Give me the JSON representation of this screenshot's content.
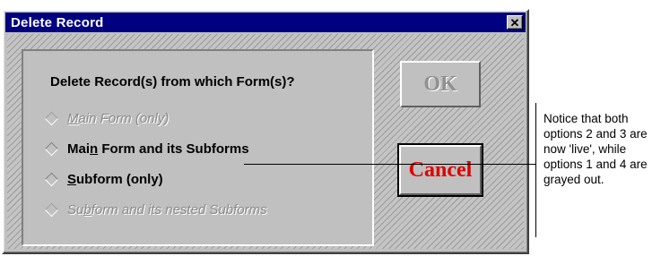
{
  "window": {
    "title": "Delete Record",
    "close_glyph": "✕"
  },
  "group": {
    "title": "Delete Record(s) from which Form(s)?",
    "options": [
      {
        "pre": "",
        "key": "M",
        "post": "ain Form (only)",
        "enabled": false
      },
      {
        "pre": "Mai",
        "key": "n",
        "post": " Form and its Subforms",
        "enabled": true
      },
      {
        "pre": "",
        "key": "S",
        "post": "ubform (only)",
        "enabled": true
      },
      {
        "pre": "Su",
        "key": "b",
        "post": "form and its nested Subforms",
        "enabled": false
      }
    ]
  },
  "buttons": {
    "ok_label": "OK",
    "cancel_label": "Cancel"
  },
  "annotation": {
    "text": "Notice that both options 2 and 3 are now 'live', while options 1 and 4 are grayed out."
  },
  "colors": {
    "titlebar": "#000080",
    "dialog_face": "#c0c0c0",
    "cancel_text": "#e00000",
    "disabled_text": "#8a8a8a"
  }
}
